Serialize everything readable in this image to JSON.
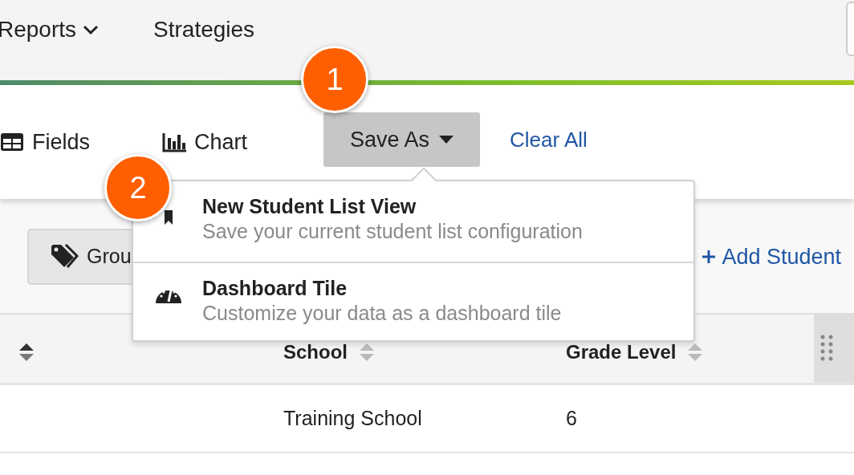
{
  "nav": {
    "items": [
      {
        "label": "Reports",
        "dropdown": true
      },
      {
        "label": "Strategies",
        "dropdown": false
      }
    ]
  },
  "toolbar": {
    "items": [
      {
        "label": "Fields",
        "kind": "fields"
      },
      {
        "label": "Chart",
        "kind": "chart"
      }
    ],
    "save_button": {
      "label": "Save As",
      "expanded": true
    },
    "clear_link": "Clear All"
  },
  "filters": {
    "group_button": "Grou",
    "add_link": "Add Student"
  },
  "save_menu": {
    "items": [
      {
        "title": "New Student List View",
        "description": "Save your current student list configuration",
        "kind": "list"
      },
      {
        "title": "Dashboard Tile",
        "description": "Customize your data as a dashboard tile",
        "kind": "dashboard"
      }
    ]
  },
  "callouts": [
    "1",
    "2"
  ],
  "table": {
    "columns": [
      {
        "kind": "sort-only",
        "sort_active": true
      },
      {
        "kind": "plain",
        "label": "School",
        "sort_active": false
      },
      {
        "kind": "plain",
        "label": "Grade Level",
        "sort_active": false
      },
      {
        "kind": "dragged"
      }
    ],
    "rows": [
      {
        "cells": [
          "",
          "Training School",
          "6"
        ]
      }
    ]
  }
}
